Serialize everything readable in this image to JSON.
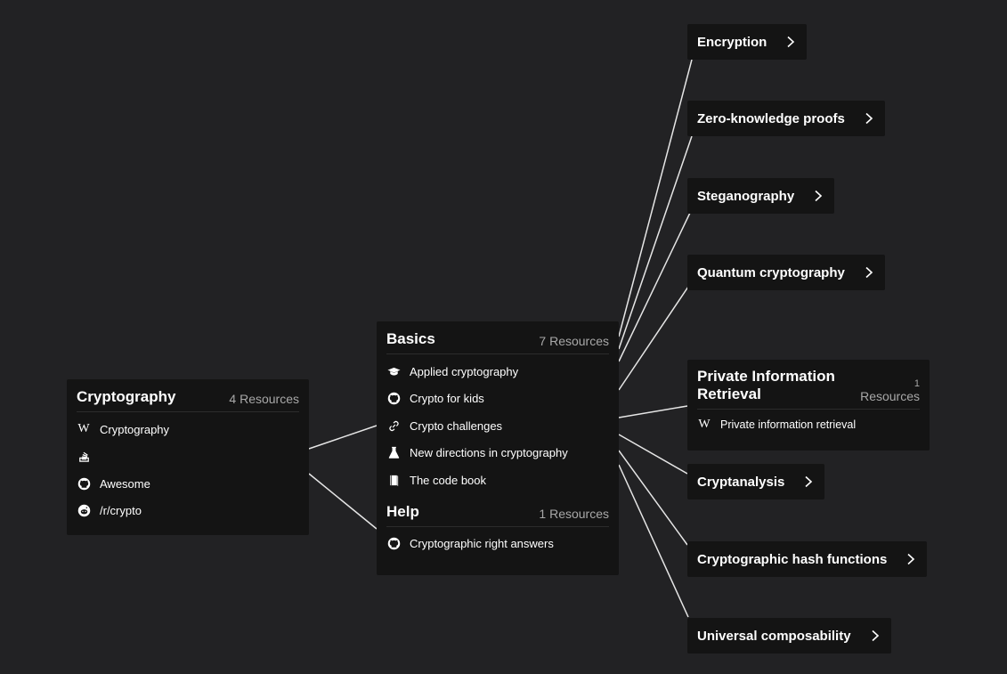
{
  "root": {
    "title": "Cryptography",
    "count": "4 Resources",
    "resources": [
      {
        "icon": "wikipedia-icon",
        "label": "Cryptography"
      },
      {
        "icon": "stackexchange-icon",
        "label": ""
      },
      {
        "icon": "github-icon",
        "label": "Awesome"
      },
      {
        "icon": "reddit-icon",
        "label": "/r/crypto"
      }
    ]
  },
  "center": {
    "basics": {
      "title": "Basics",
      "count": "7 Resources",
      "resources": [
        {
          "icon": "graduation-cap-icon",
          "label": "Applied cryptography"
        },
        {
          "icon": "github-icon",
          "label": "Crypto for kids"
        },
        {
          "icon": "link-icon",
          "label": "Crypto challenges"
        },
        {
          "icon": "flask-icon",
          "label": "New directions in cryptography"
        },
        {
          "icon": "book-icon",
          "label": "The code book"
        }
      ]
    },
    "help": {
      "title": "Help",
      "count": "1 Resources",
      "resources": [
        {
          "icon": "github-icon",
          "label": "Cryptographic right answers"
        }
      ]
    }
  },
  "topics": [
    {
      "label": "Encryption"
    },
    {
      "label": "Zero-knowledge proofs"
    },
    {
      "label": "Steganography"
    },
    {
      "label": "Quantum cryptography"
    },
    {
      "label": "Cryptanalysis"
    },
    {
      "label": "Cryptographic hash functions"
    },
    {
      "label": "Universal composability"
    }
  ],
  "pir": {
    "title": "Private Information Retrieval",
    "count_num": "1",
    "count_word": "Resources",
    "resources": [
      {
        "icon": "wikipedia-icon",
        "label": "Private information retrieval"
      }
    ]
  },
  "colors": {
    "background": "#222224",
    "node": "#141414",
    "edge": "#e6e6e6",
    "muted": "#a8a8a8"
  }
}
